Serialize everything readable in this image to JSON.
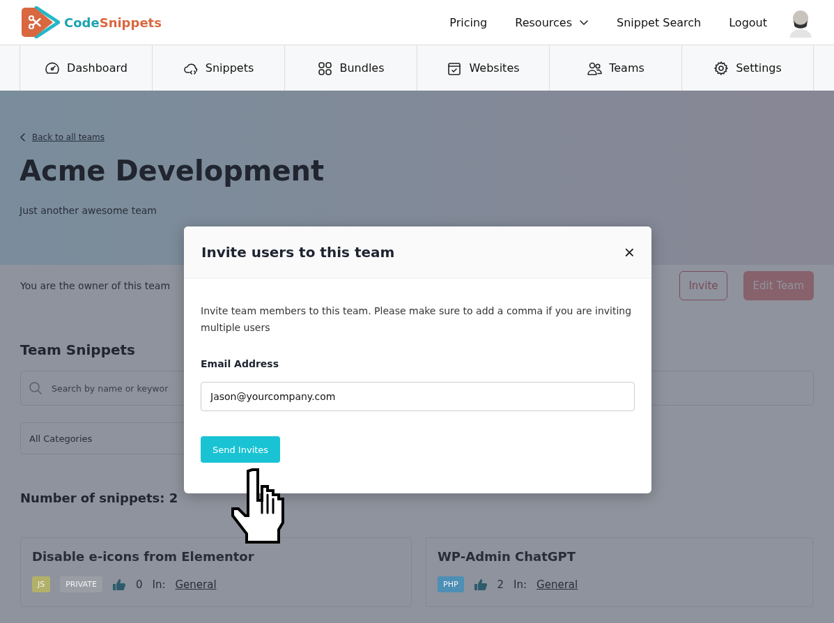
{
  "header": {
    "logo": {
      "part_1": "Code",
      "part_2": "Snippets"
    },
    "links": [
      {
        "label": "Pricing",
        "dropdown": false
      },
      {
        "label": "Resources",
        "dropdown": true
      },
      {
        "label": "Snippet Search",
        "dropdown": false
      },
      {
        "label": "Logout",
        "dropdown": false
      }
    ]
  },
  "nav": [
    {
      "label": "Dashboard"
    },
    {
      "label": "Snippets"
    },
    {
      "label": "Bundles"
    },
    {
      "label": "Websites"
    },
    {
      "label": "Teams"
    },
    {
      "label": "Settings"
    }
  ],
  "team": {
    "back_link": "Back to all teams",
    "title": "Acme Development",
    "description": "Just another awesome team",
    "owner_note": "You are the owner of this team",
    "buttons": [
      {
        "label": "Invite",
        "kind": "outline"
      },
      {
        "label": "Edit Team",
        "kind": "filled"
      }
    ]
  },
  "snippets_section": {
    "heading": "Team Snippets",
    "search": {
      "placeholder": "Search by name or keywor"
    },
    "category": {
      "value": "All Categories"
    },
    "count": "Number of snippets: 2",
    "cards": [
      {
        "title": "Disable e-icons from Elementor",
        "tags": [
          {
            "label": "JS",
            "color": "#b3b06a"
          },
          {
            "label": "PRIVATE",
            "color": "#9b9da5"
          }
        ],
        "likes": "0",
        "category_label": "In:",
        "category": "General"
      },
      {
        "title": "WP-Admin ChatGPT",
        "tags": [
          {
            "label": "PHP",
            "color": "#4e8fb5"
          }
        ],
        "likes": "2",
        "category_label": "In:",
        "category": "General"
      }
    ]
  },
  "modal": {
    "title": "Invite users to this team",
    "close": "×",
    "text": "Invite team members to this team. Please make sure to add a comma if you are inviting multiple users",
    "field_label": "Email Address",
    "field_value": "Jason@yourcompany.com",
    "submit": "Send Invites"
  }
}
